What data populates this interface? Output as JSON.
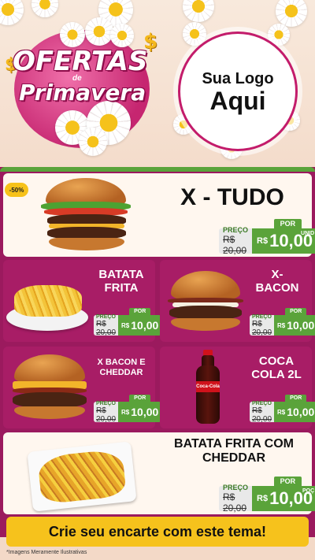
{
  "header": {
    "headline_line1": "OFERTAS",
    "headline_de": "de",
    "headline_line2": "Primavera",
    "logo_line1": "Sua Logo",
    "logo_line2": "Aqui"
  },
  "badge": "-50%",
  "products": [
    {
      "title": "X - TUDO",
      "price_label": "PREÇO",
      "old_price": "R$ 20,00",
      "tab": "POR",
      "currency": "R$",
      "price": "10,00",
      "unit": "UNID"
    },
    {
      "title": "BATATA FRITA",
      "price_label": "PREÇO",
      "old_price": "R$ 20,00",
      "tab": "POR",
      "currency": "R$",
      "price": "10,00"
    },
    {
      "title": "X- BACON",
      "price_label": "PREÇO",
      "old_price": "R$ 20,00",
      "tab": "POR",
      "currency": "R$",
      "price": "10,00"
    },
    {
      "title": "X BACON E CHEDDAR",
      "price_label": "PREÇO",
      "old_price": "R$ 20,00",
      "tab": "POR",
      "currency": "R$",
      "price": "10,00"
    },
    {
      "title": "COCA COLA 2L",
      "price_label": "PREÇO",
      "old_price": "R$ 20,00",
      "tab": "POR",
      "currency": "R$",
      "price": "10,00",
      "bottle_label": "Coca-Cola"
    },
    {
      "title": "BATATA FRITA COM CHEDDAR",
      "price_label": "PREÇO",
      "old_price": "R$ 20,00",
      "tab": "POR",
      "currency": "R$",
      "price": "10,00",
      "unit": "POÇ"
    }
  ],
  "banner": "Crie seu encarte com este tema!",
  "footnote": "*Imagens Meramente Ilustrativas",
  "colors": {
    "magenta": "#9b1a5e",
    "green": "#5aa33a",
    "yellow": "#f6c21c",
    "cream": "#fff7ef"
  }
}
